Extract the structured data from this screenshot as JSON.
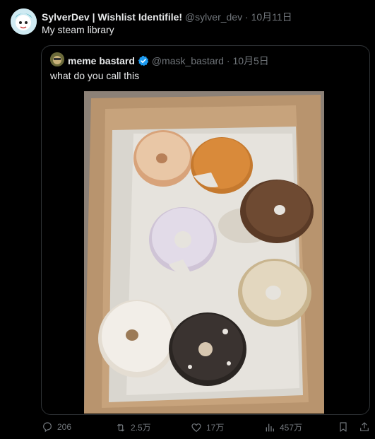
{
  "tweet": {
    "author_name": "SylverDev | Wishlist Identifile!",
    "author_handle": "@sylver_dev",
    "date": "10月11日",
    "text": "My steam library"
  },
  "quote": {
    "author_name": "meme bastard",
    "author_handle": "@mask_bastard",
    "date": "10月5日",
    "text": "what do you call this",
    "image_alt": "photo of half-eaten donuts in a cardboard box"
  },
  "actions": {
    "replies": "206",
    "reposts": "2.5万",
    "likes": "17万",
    "views": "457万"
  },
  "colors": {
    "background": "#000000",
    "text": "#e7e9ea",
    "muted": "#71767b",
    "verified": "#1d9bf0"
  }
}
